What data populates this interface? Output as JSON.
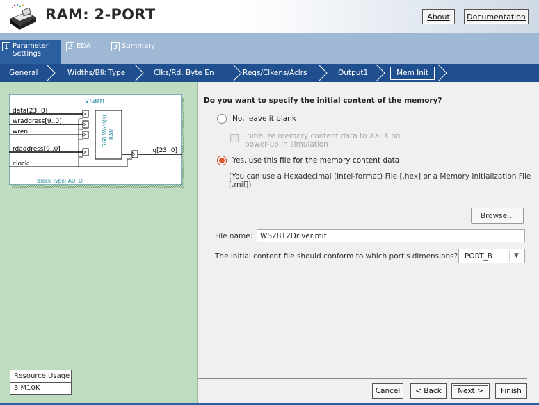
{
  "header": {
    "title": "RAM: 2-PORT",
    "about_label": "About",
    "documentation_label": "Documentation"
  },
  "steps": [
    {
      "num": "1",
      "label_line1": "Parameter",
      "label_line2": "Settings"
    },
    {
      "num": "2",
      "label_line1": "EDA",
      "label_line2": ""
    },
    {
      "num": "3",
      "label_line1": "Summary",
      "label_line2": ""
    }
  ],
  "breadcrumbs": [
    "General",
    "Widths/Blk Type",
    "Clks/Rd, Byte En",
    "Regs/Clkens/Aclrs",
    "Output1",
    "Mem Init"
  ],
  "diagram": {
    "title": "vram",
    "inputs": [
      "data[23..0]",
      "wraddress[9..0]",
      "wren",
      "rdaddress[9..0]",
      "clock"
    ],
    "output": "q[23..0]",
    "block_words": "768 Word(s)",
    "block_type_label": "RAM",
    "block_type": "Block Type: AUTO"
  },
  "resource": {
    "title": "Resource Usage",
    "value": "3 M10K"
  },
  "form": {
    "question": "Do you want to specify the initial content of the memory?",
    "option_no": "No, leave it blank",
    "init_line1": "Initialize memory content data to XX..X on",
    "init_line2": "power-up in simulation",
    "option_yes": "Yes, use this file for the memory content data",
    "hint_line1": "(You can use a Hexadecimal (Intel-format) File [.hex] or a Memory Initialization File",
    "hint_line2": "[.mif])",
    "browse_label": "Browse...",
    "file_name_label": "File name:",
    "file_name_value": "WS2812Driver.mif",
    "port_question": "The initial content file should conform to which port's dimensions?",
    "port_value": "PORT_B"
  },
  "footer": {
    "cancel": "Cancel",
    "back": "< Back",
    "next": "Next >",
    "finish": "Finish"
  }
}
